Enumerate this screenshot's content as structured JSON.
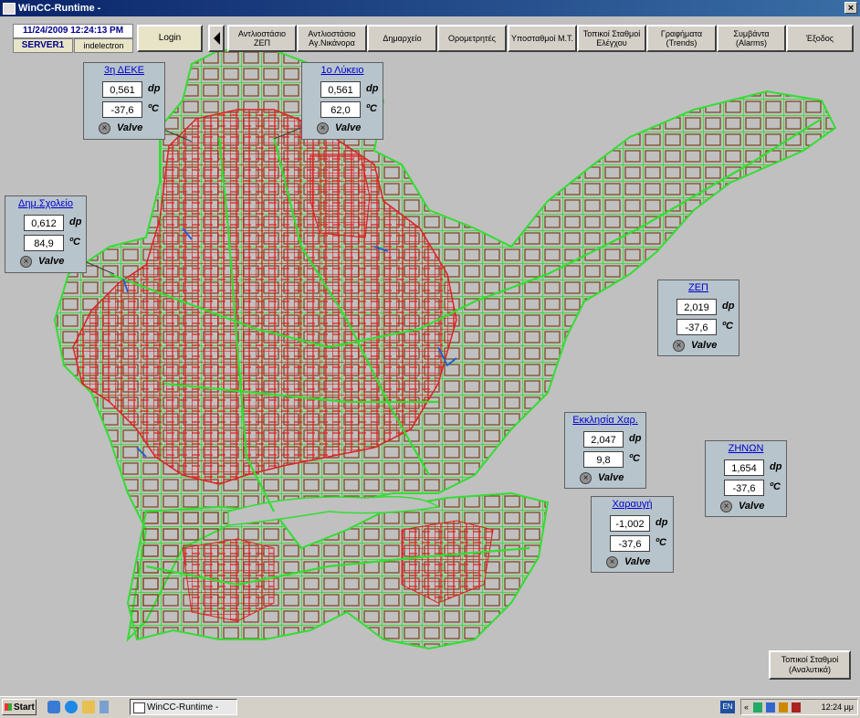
{
  "window": {
    "title": "WinCC-Runtime -",
    "close_glyph": "×"
  },
  "header": {
    "datetime": "11/24/2009 12:24:13 PM",
    "server": "SERVER1",
    "user": "indelectron",
    "login_label": "Login"
  },
  "menu": [
    {
      "label": "Αντλιοστάσιο ΖΕΠ"
    },
    {
      "label": "Αντλιοστάσιο Αγ.Νικάνορα"
    },
    {
      "label": "Δημαρχείο"
    },
    {
      "label": "Ορομετρητές"
    },
    {
      "label": "Υποσταθμοί Μ.Τ."
    },
    {
      "label": "Τοπικοί Σταθμοί Ελέγχου"
    },
    {
      "label": "Γραφήματα (Trends)"
    },
    {
      "label": "Συμβάντα (Alarms)"
    },
    {
      "label": "Έξοδος"
    }
  ],
  "stations": [
    {
      "title": "3η ΔΕΚΕ",
      "dp": "0,561",
      "temp": "-37,6",
      "dp_unit": "dp",
      "temp_unit": "ºC",
      "valve_label": "Valve"
    },
    {
      "title": "1ο Λύκειο",
      "dp": "0,561",
      "temp": "62,0",
      "dp_unit": "dp",
      "temp_unit": "ºC",
      "valve_label": "Valve"
    },
    {
      "title": "Δημ.Σχολείο",
      "dp": "0,612",
      "temp": "84,9",
      "dp_unit": "dp",
      "temp_unit": "ºC",
      "valve_label": "Valve"
    },
    {
      "title": "ΖΕΠ",
      "dp": "2,019",
      "temp": "-37,6",
      "dp_unit": "dp",
      "temp_unit": "ºC",
      "valve_label": "Valve"
    },
    {
      "title": "Εκκλησία Χαρ.",
      "dp": "2,047",
      "temp": "9,8",
      "dp_unit": "dp",
      "temp_unit": "ºC",
      "valve_label": "Valve"
    },
    {
      "title": "ΖΗΝΩΝ",
      "dp": "1,654",
      "temp": "-37,6",
      "dp_unit": "dp",
      "temp_unit": "ºC",
      "valve_label": "Valve"
    },
    {
      "title": "Χαραυγή",
      "dp": "-1,002",
      "temp": "-37,6",
      "dp_unit": "dp",
      "temp_unit": "ºC",
      "valve_label": "Valve"
    }
  ],
  "local_stations_button": "Τοπικοί Σταθμοί (Αναλυτικά)",
  "taskbar": {
    "start_label": "Start",
    "task_label": "WinCC-Runtime -",
    "language": "EN",
    "tray_chevron": "«",
    "clock": "12:24 μμ"
  },
  "colors": {
    "network_main": "#33dd33",
    "network_distribution": "#dd2222",
    "pipe_brown": "#7a4a20",
    "panel_bg": "#b8c4cc"
  }
}
